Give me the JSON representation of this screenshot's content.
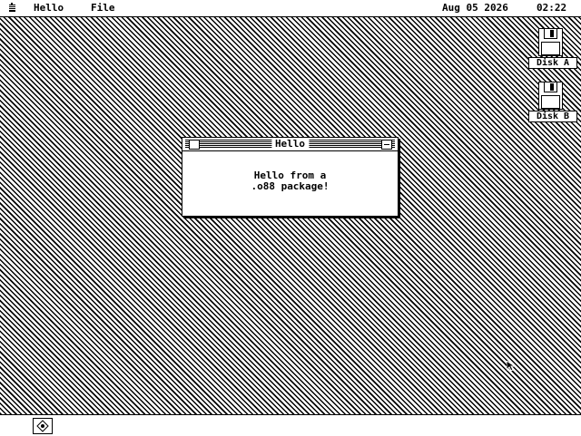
{
  "menubar": {
    "apple_icon": "apple-menu-icon",
    "items": [
      "Hello",
      "File"
    ],
    "date": "Aug 05 2026",
    "time": "02:22"
  },
  "desktop": {
    "disks": [
      {
        "label": "Disk A",
        "icon": "floppy-disk-icon"
      },
      {
        "label": "Disk B",
        "icon": "floppy-disk-icon"
      }
    ]
  },
  "window": {
    "title": "Hello",
    "message_line1": "Hello from a",
    "message_line2": ".o88 package!"
  },
  "dock": {
    "icon": "disk-drive-icon"
  }
}
